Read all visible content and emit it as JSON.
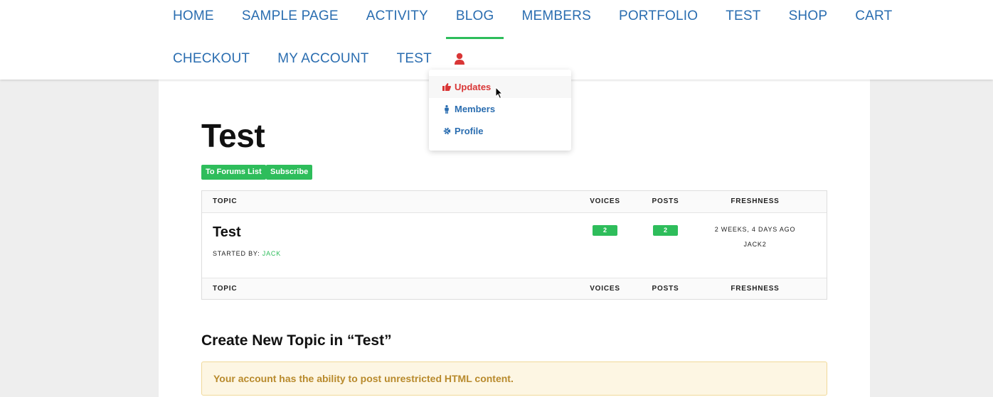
{
  "nav": {
    "row1": [
      "HOME",
      "SAMPLE PAGE",
      "ACTIVITY",
      "BLOG",
      "MEMBERS",
      "PORTFOLIO",
      "TEST",
      "SHOP",
      "CART"
    ],
    "row2": [
      "CHECKOUT",
      "MY ACCOUNT",
      "TEST"
    ],
    "active": "BLOG",
    "user_icon": "user-icon"
  },
  "dropdown": {
    "items": [
      {
        "label": "Updates",
        "icon": "thumbs-up-icon",
        "hovered": true
      },
      {
        "label": "Members",
        "icon": "person-icon",
        "hovered": false
      },
      {
        "label": "Profile",
        "icon": "gear-icon",
        "hovered": false
      }
    ]
  },
  "page": {
    "title": "Test",
    "buttons": {
      "forums": "To Forums List",
      "subscribe": "Subscribe"
    }
  },
  "forum_table": {
    "headers": {
      "topic": "Topic",
      "voices": "Voices",
      "posts": "Posts",
      "freshness": "Freshness"
    },
    "rows": [
      {
        "title": "Test",
        "started_by_label": "Started by:",
        "author": "jack",
        "voices": "2",
        "posts": "2",
        "freshness": "2 weeks, 4 days ago",
        "last_user": "jack2"
      }
    ]
  },
  "create": {
    "heading": "Create New Topic in “Test”",
    "notice": "Your account has the ability to post unrestricted HTML content."
  },
  "colors": {
    "link_blue": "#2a6db0",
    "accent_green": "#2ebd5b",
    "hover_red": "#d93636",
    "notice_bg": "#fdf6e3",
    "notice_text": "#b88a2c"
  }
}
